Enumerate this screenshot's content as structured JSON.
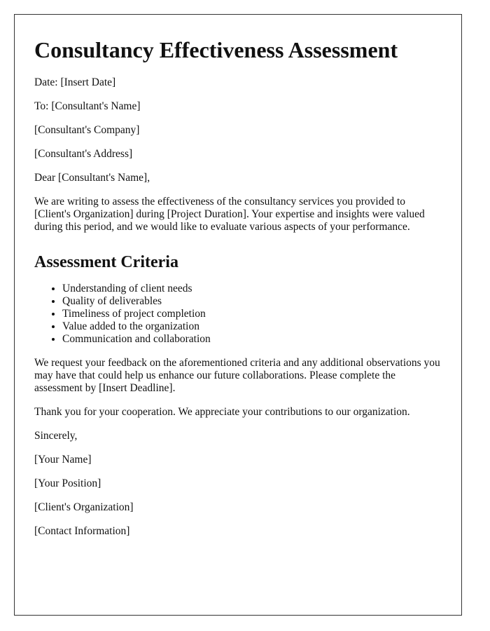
{
  "title": "Consultancy Effectiveness Assessment",
  "header_lines": [
    "Date: [Insert Date]",
    "To: [Consultant's Name]",
    "[Consultant's Company]",
    "[Consultant's Address]"
  ],
  "salutation": "Dear [Consultant's Name],",
  "intro": "We are writing to assess the effectiveness of the consultancy services you provided to [Client's Organization] during [Project Duration]. Your expertise and insights were valued during this period, and we would like to evaluate various aspects of your performance.",
  "criteria_heading": "Assessment Criteria",
  "criteria": [
    "Understanding of client needs",
    "Quality of deliverables",
    "Timeliness of project completion",
    "Value added to the organization",
    "Communication and collaboration"
  ],
  "request": "We request your feedback on the aforementioned criteria and any additional observations you may have that could help us enhance our future collaborations. Please complete the assessment by [Insert Deadline].",
  "thanks": "Thank you for your cooperation. We appreciate your contributions to our organization.",
  "closing": "Sincerely,",
  "signature_lines": [
    "[Your Name]",
    "[Your Position]",
    "[Client's Organization]",
    "[Contact Information]"
  ]
}
